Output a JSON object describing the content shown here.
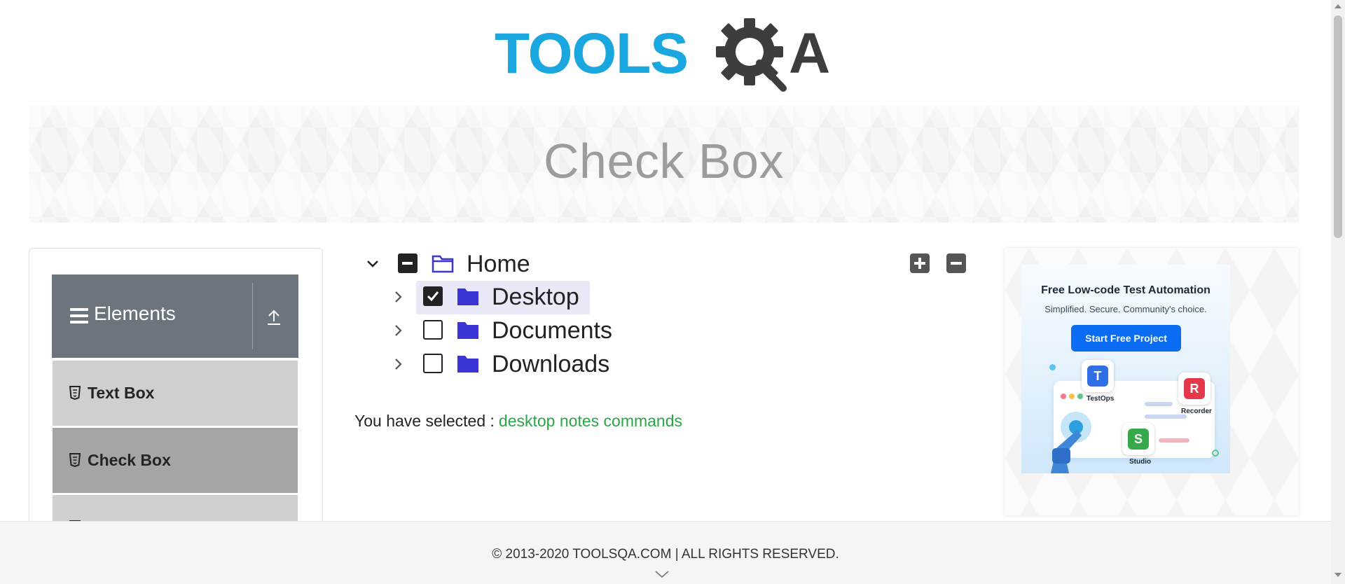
{
  "logo": {
    "part1": "TOOLS",
    "part2": "A",
    "colors": {
      "tools": "#1aa7e0",
      "qa": "#3d3d3d"
    },
    "icon": "gear-magnifier-icon"
  },
  "header": {
    "title": "Check Box"
  },
  "sidebar": {
    "group": {
      "label": "Elements",
      "icon": "hamburger-icon",
      "toggle_icon": "upload-arrow-icon"
    },
    "items": [
      {
        "label": "Text Box",
        "icon": "html5-icon",
        "active": false
      },
      {
        "label": "Check Box",
        "icon": "html5-icon",
        "active": true
      },
      {
        "label": "",
        "icon": "html5-icon",
        "active": false
      }
    ]
  },
  "tree": {
    "expand_all_icon": "plus-square-icon",
    "collapse_all_icon": "minus-square-icon",
    "nodes": [
      {
        "label": "Home",
        "state": "partial",
        "expanded": true,
        "folder": "folder-open-icon"
      },
      {
        "label": "Desktop",
        "state": "checked",
        "expanded": false,
        "folder": "folder-icon",
        "highlighted": true
      },
      {
        "label": "Documents",
        "state": "unchecked",
        "expanded": false,
        "folder": "folder-icon"
      },
      {
        "label": "Downloads",
        "state": "unchecked",
        "expanded": false,
        "folder": "folder-icon"
      }
    ]
  },
  "result": {
    "prefix": "You have selected :",
    "items": "desktop notes commands",
    "color": "#28a745"
  },
  "ad": {
    "title": "Free Low-code Test Automation",
    "subtitle": "Simplified. Secure. Community's choice.",
    "button": "Start Free Project",
    "products": [
      "TestOps",
      "Recorder",
      "Studio"
    ]
  },
  "footer": {
    "text": "© 2013-2020 TOOLSQA.COM | ALL RIGHTS RESERVED."
  },
  "colors": {
    "accent": "#0a6cf2",
    "folder": "#3b35d4",
    "sidebar_header": "#6c757d",
    "menu_item": "#cfcfcf",
    "menu_active": "#a5a5a5"
  }
}
